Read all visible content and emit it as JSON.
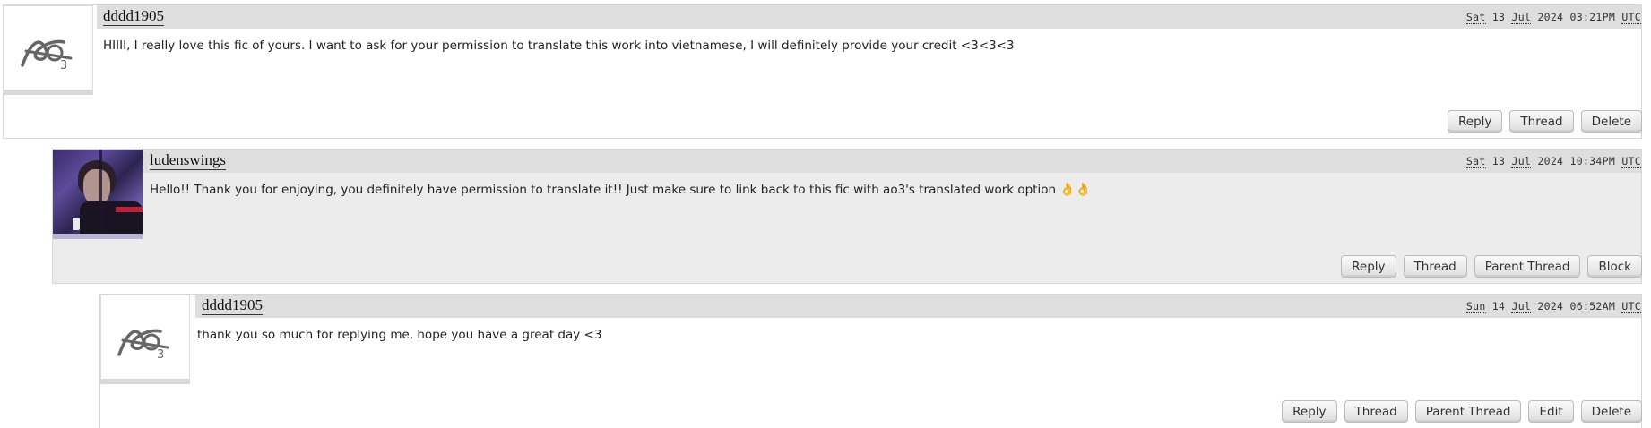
{
  "comments": [
    {
      "username": "dddd1905",
      "date": {
        "day": "Sat",
        "date": "13",
        "month": "Jul",
        "year": "2024",
        "time": "03:21PM",
        "tz": "UTC"
      },
      "text": "HIIII, I really love this fic of yours. I want to ask for your permission to translate this work into vietnamese, I will definitely provide your credit <3<3<3",
      "actions": [
        "Reply",
        "Thread",
        "Delete"
      ]
    },
    {
      "username": "ludenswings",
      "date": {
        "day": "Sat",
        "date": "13",
        "month": "Jul",
        "year": "2024",
        "time": "10:34PM",
        "tz": "UTC"
      },
      "text": "Hello!! Thank you for enjoying, you definitely have permission to translate it!! Just make sure to link back to this fic with ao3's translated work option",
      "emoji": "👌👌",
      "actions": [
        "Reply",
        "Thread",
        "Parent Thread",
        "Block"
      ]
    },
    {
      "username": "dddd1905",
      "date": {
        "day": "Sun",
        "date": "14",
        "month": "Jul",
        "year": "2024",
        "time": "06:52AM",
        "tz": "UTC"
      },
      "text": "thank you so much for replying me, hope you have a great day <3",
      "actions": [
        "Reply",
        "Thread",
        "Parent Thread",
        "Edit",
        "Delete"
      ]
    }
  ]
}
